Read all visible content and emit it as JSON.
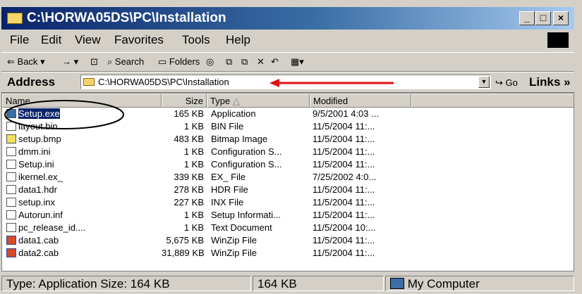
{
  "window": {
    "title": "C:\\HORWA05DS\\PC\\Installation",
    "controls": [
      "_",
      "□",
      "×"
    ]
  },
  "menu": [
    "File",
    "Edit",
    "View",
    "Favorites",
    "Tools",
    "Help"
  ],
  "toolbar": {
    "back": "Back",
    "search": "Search",
    "folders": "Folders"
  },
  "address": {
    "label": "Address",
    "path": "C:\\HORWA05DS\\PC\\Installation",
    "go": "Go",
    "links": "Links »"
  },
  "columns": [
    "Name",
    "Size",
    "Type",
    "Modified"
  ],
  "files": [
    {
      "name": "Setup.exe",
      "size": "165 KB",
      "type": "Application",
      "modified": "9/5/2001 4:03 ...",
      "icon": "application-icon"
    },
    {
      "name": "layout.bin",
      "size": "1 KB",
      "type": "BIN File",
      "modified": "11/5/2004 11:...",
      "icon": "file-icon"
    },
    {
      "name": "setup.bmp",
      "size": "483 KB",
      "type": "Bitmap Image",
      "modified": "11/5/2004 11:...",
      "icon": "bitmap-icon"
    },
    {
      "name": "dmm.ini",
      "size": "1 KB",
      "type": "Configuration S...",
      "modified": "11/5/2004 11:...",
      "icon": "config-icon"
    },
    {
      "name": "Setup.ini",
      "size": "1 KB",
      "type": "Configuration S...",
      "modified": "11/5/2004 11:...",
      "icon": "config-icon"
    },
    {
      "name": "ikernel.ex_",
      "size": "339 KB",
      "type": "EX_ File",
      "modified": "7/25/2002 4:0...",
      "icon": "file-icon"
    },
    {
      "name": "data1.hdr",
      "size": "278 KB",
      "type": "HDR File",
      "modified": "11/5/2004 11:...",
      "icon": "file-icon"
    },
    {
      "name": "setup.inx",
      "size": "227 KB",
      "type": "INX File",
      "modified": "11/5/2004 11:...",
      "icon": "file-icon"
    },
    {
      "name": "Autorun.inf",
      "size": "1 KB",
      "type": "Setup Informati...",
      "modified": "11/5/2004 11:...",
      "icon": "config-icon"
    },
    {
      "name": "pc_release_id....",
      "size": "1 KB",
      "type": "Text Document",
      "modified": "11/5/2004 10:...",
      "icon": "text-icon"
    },
    {
      "name": "data1.cab",
      "size": "5,675 KB",
      "type": "WinZip File",
      "modified": "11/5/2004 11:...",
      "icon": "winzip-icon"
    },
    {
      "name": "data2.cab",
      "size": "31,889 KB",
      "type": "WinZip File",
      "modified": "11/5/2004 11:...",
      "icon": "winzip-icon"
    }
  ],
  "status": {
    "info": "Type: Application Size: 164 KB",
    "size": "164 KB",
    "zone": "My Computer"
  },
  "colors": {
    "title_bar": "#0a246a",
    "annotation": "#e01010",
    "selection": "#0a246a"
  }
}
